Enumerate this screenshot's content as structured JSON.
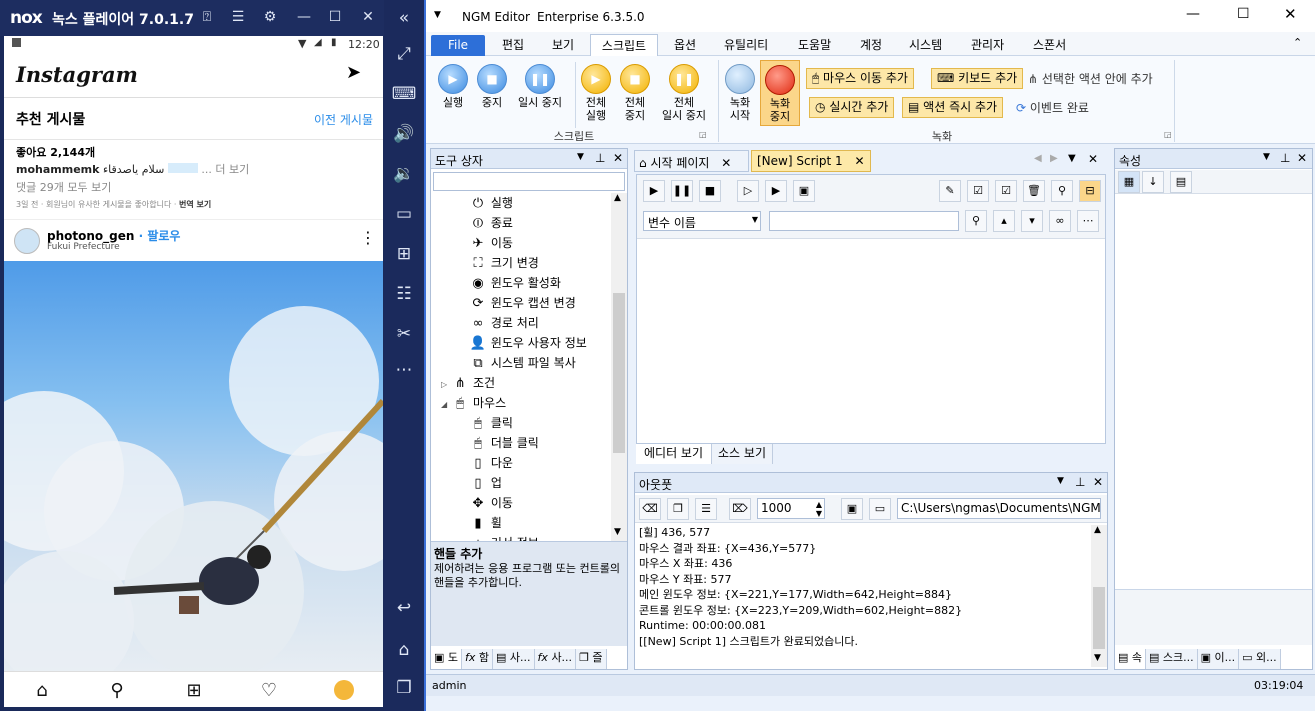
{
  "nox": {
    "logo": "nox",
    "title": "녹스 플레이어 7.0.1.7",
    "status_time": "12:20",
    "instagram": {
      "logo": "Instagram",
      "section_title": "추천 게시물",
      "prev_posts": "이전 게시물",
      "likes": "좋아요 2,144개",
      "caption_user": "mohammemk",
      "caption_text": "سلام ياصدقاء",
      "more": "... 더 보기",
      "comments": "댓글 29개 모두 보기",
      "meta": "3일 전 · 회원님이 유사한 게시물을 좋아합니다 · ",
      "translate": "번역 보기",
      "poster_name": "photono_gen",
      "follow": "· 팔로우",
      "poster_location": "Fukui Prefecture"
    }
  },
  "ngm": {
    "title": "NGM Editor",
    "edition": "Enterprise 6.3.5.0",
    "menu": [
      "File",
      "편집",
      "보기",
      "스크립트",
      "옵션",
      "유틸리티",
      "도움말",
      "계정",
      "시스템",
      "관리자",
      "스폰서"
    ],
    "ribbon": {
      "script_buttons": [
        {
          "label1": "실행",
          "label2": ""
        },
        {
          "label1": "중지",
          "label2": ""
        },
        {
          "label1": "일시 중지",
          "label2": ""
        },
        {
          "label1": "전체",
          "label2": "실행"
        },
        {
          "label1": "전체",
          "label2": "중지"
        },
        {
          "label1": "전체",
          "label2": "일시 중지"
        }
      ],
      "script_group": "스크립트",
      "record_buttons": [
        {
          "label1": "녹화",
          "label2": "시작"
        },
        {
          "label1": "녹화",
          "label2": "중지"
        }
      ],
      "mouse_move_add": "마우스 이동 추가",
      "keyboard_add": "키보드 추가",
      "add_in_selected": "선택한 액션 안에 추가",
      "realtime_add": "실시간 추가",
      "action_instant_add": "액션 즉시 추가",
      "event_complete": "이벤트 완료",
      "record_group": "녹화"
    },
    "toolbox": {
      "title": "도구 상자",
      "items": [
        {
          "label": "실행",
          "icon": "run-icon",
          "indent": 2
        },
        {
          "label": "종료",
          "icon": "exit-icon",
          "indent": 2
        },
        {
          "label": "이동",
          "icon": "move-icon",
          "indent": 2
        },
        {
          "label": "크기 변경",
          "icon": "resize-icon",
          "indent": 2
        },
        {
          "label": "윈도우 활성화",
          "icon": "activate-icon",
          "indent": 2
        },
        {
          "label": "윈도우 캡션 변경",
          "icon": "caption-icon",
          "indent": 2
        },
        {
          "label": "경로 처리",
          "icon": "path-icon",
          "indent": 2
        },
        {
          "label": "윈도우 사용자 정보",
          "icon": "user-icon",
          "indent": 2
        },
        {
          "label": "시스템 파일 복사",
          "icon": "copy-icon",
          "indent": 2
        },
        {
          "label": "조건",
          "icon": "condition-icon",
          "indent": 1
        },
        {
          "label": "마우스",
          "icon": "mouse-icon",
          "indent": 1
        },
        {
          "label": "클릭",
          "icon": "click-icon",
          "indent": 2
        },
        {
          "label": "더블 클릭",
          "icon": "double-click-icon",
          "indent": 2
        },
        {
          "label": "다운",
          "icon": "mouse-down-icon",
          "indent": 2
        },
        {
          "label": "업",
          "icon": "mouse-up-icon",
          "indent": 2
        },
        {
          "label": "이동",
          "icon": "mouse-move-icon",
          "indent": 2
        },
        {
          "label": "휠",
          "icon": "wheel-icon",
          "indent": 2
        },
        {
          "label": "커서 정보",
          "icon": "cursor-icon",
          "indent": 2
        }
      ],
      "desc_title": "핸들 추가",
      "desc_text": "제어하려는 응용 프로그램 또는 컨트롤의 핸들을 추가합니다.",
      "bottom_tabs": [
        "도",
        "함",
        "사...",
        "사...",
        "즐"
      ]
    },
    "editor": {
      "tabs": [
        "시작 페이지",
        "[New] Script 1"
      ],
      "var_select": "변수 이름",
      "bottom_tabs": [
        "에디터 보기",
        "소스 보기"
      ]
    },
    "output": {
      "title": "아웃풋",
      "count": "1000",
      "path": "C:\\Users\\ngmas\\Documents\\NGM6\\",
      "lines": [
        "[휠] 436, 577",
        "마우스 결과 좌표: {X=436,Y=577}",
        "마우스 X 좌표: 436",
        "마우스 Y 좌표: 577",
        "메인 윈도우 정보: {X=221,Y=177,Width=642,Height=884}",
        "콘트롤 윈도우 정보: {X=223,Y=209,Width=602,Height=882}",
        "Runtime: 00:00:00.081",
        "[[New] Script 1] 스크립트가 완료되었습니다."
      ]
    },
    "properties": {
      "title": "속성",
      "bottom_tabs": [
        "속",
        "스크...",
        "이...",
        "외..."
      ]
    },
    "status": {
      "user": "admin",
      "time": "03:19:04"
    }
  }
}
